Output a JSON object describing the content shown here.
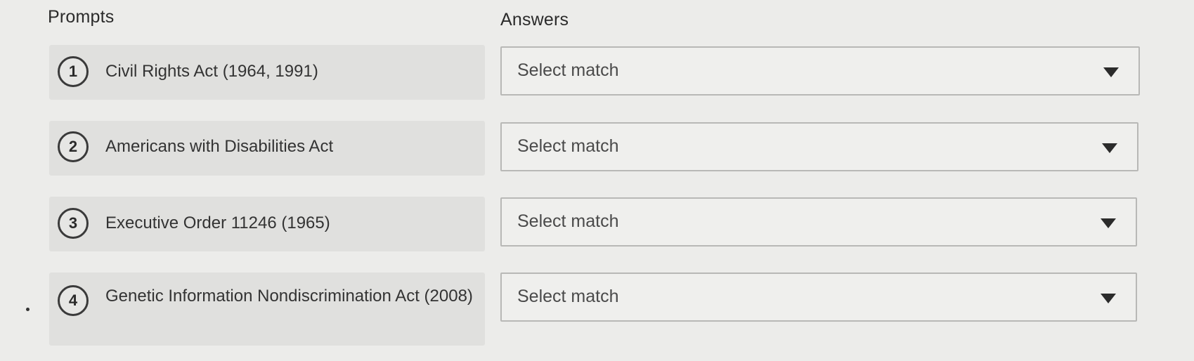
{
  "headers": {
    "prompts": "Prompts",
    "answers": "Answers"
  },
  "prompts": [
    {
      "number": "1",
      "text": "Civil Rights Act (1964, 1991)"
    },
    {
      "number": "2",
      "text": "Americans with Disabilities Act"
    },
    {
      "number": "3",
      "text": "Executive Order 11246 (1965)"
    },
    {
      "number": "4",
      "text": "Genetic Information Nondiscrimination Act (2008)"
    }
  ],
  "answers": [
    {
      "value": "Select match"
    },
    {
      "value": "Select match"
    },
    {
      "value": "Select match"
    },
    {
      "value": "Select match"
    }
  ]
}
